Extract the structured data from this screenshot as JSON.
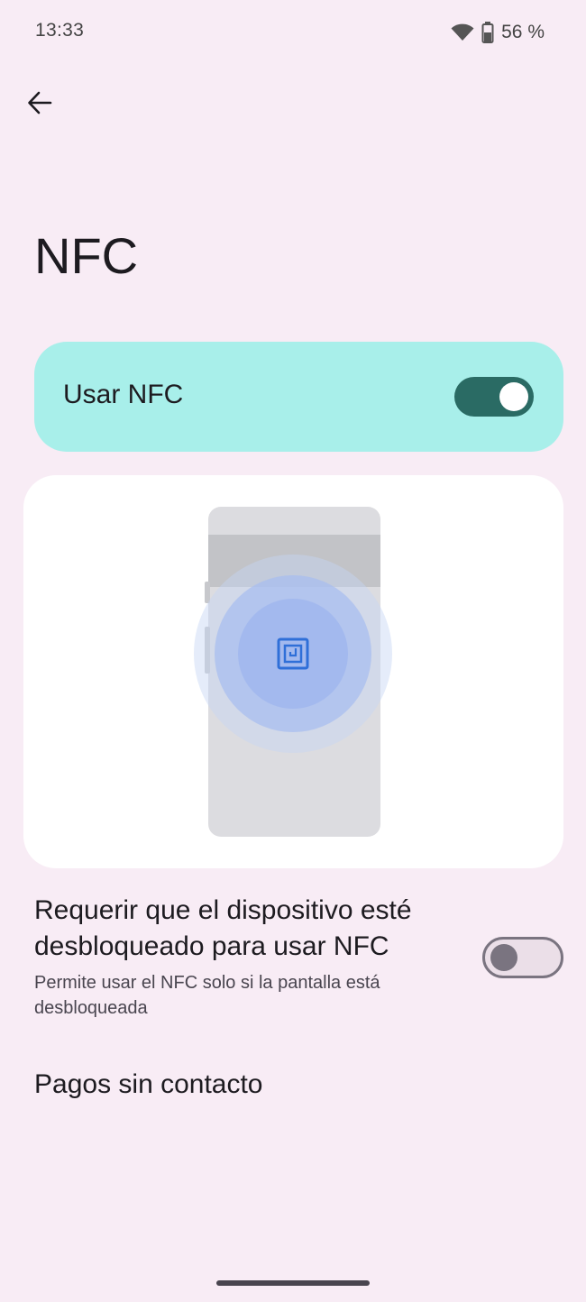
{
  "status_bar": {
    "time": "13:33",
    "battery_text": "56 %",
    "icons": [
      "wifi-icon",
      "battery-icon"
    ]
  },
  "header": {
    "back_icon": "arrow-back-icon",
    "title": "NFC"
  },
  "main_toggle": {
    "label": "Usar NFC",
    "checked": true
  },
  "illustration": {
    "icon": "nfc-icon"
  },
  "settings": {
    "require_unlock": {
      "title": "Requerir que el dispositivo esté desbloqueado para usar NFC",
      "summary": "Permite usar el NFC solo si la pantalla está desbloqueada",
      "checked": false
    },
    "contactless": {
      "title": "Pagos sin contacto"
    }
  },
  "colors": {
    "background": "#f8ecf5",
    "toggle_card": "#a8efea",
    "switch_on_track": "#2a6b64",
    "nfc_accent": "#2f6fd8"
  }
}
